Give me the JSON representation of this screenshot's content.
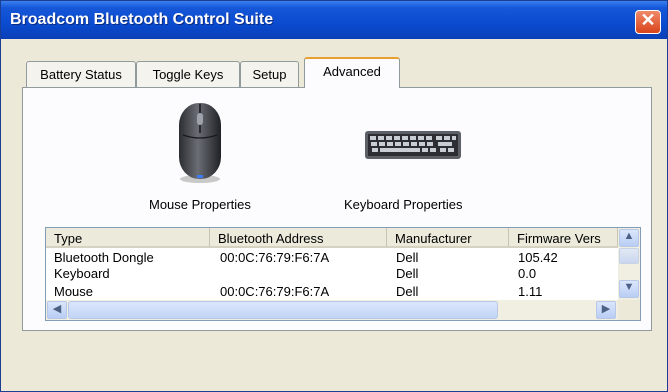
{
  "window": {
    "title": "Broadcom Bluetooth Control Suite"
  },
  "tabs": [
    {
      "label": "Battery Status"
    },
    {
      "label": "Toggle Keys"
    },
    {
      "label": "Setup"
    },
    {
      "label": "Advanced",
      "active": true
    }
  ],
  "devices": {
    "mouse": {
      "label": "Mouse Properties",
      "icon": "mouse-icon"
    },
    "keyboard": {
      "label": "Keyboard Properties",
      "icon": "keyboard-icon"
    }
  },
  "table": {
    "columns": [
      "Type",
      "Bluetooth Address",
      "Manufacturer",
      "Firmware Vers"
    ],
    "rows": [
      [
        "Bluetooth Dongle",
        "00:0C:76:79:F6:7A",
        "Dell",
        "105.42"
      ],
      [
        "Keyboard",
        "",
        "Dell",
        "0.0"
      ],
      [
        "Mouse",
        "00:0C:76:79:F6:7A",
        "Dell",
        "1.11"
      ]
    ]
  },
  "icons": {
    "close": "close-icon",
    "scroll_up": "chevron-up-icon",
    "scroll_down": "chevron-down-icon",
    "scroll_left": "chevron-left-icon",
    "scroll_right": "chevron-right-icon"
  },
  "colors": {
    "titlebar": "#0a4bd0",
    "close": "#d8431a",
    "face": "#ece9d8"
  }
}
